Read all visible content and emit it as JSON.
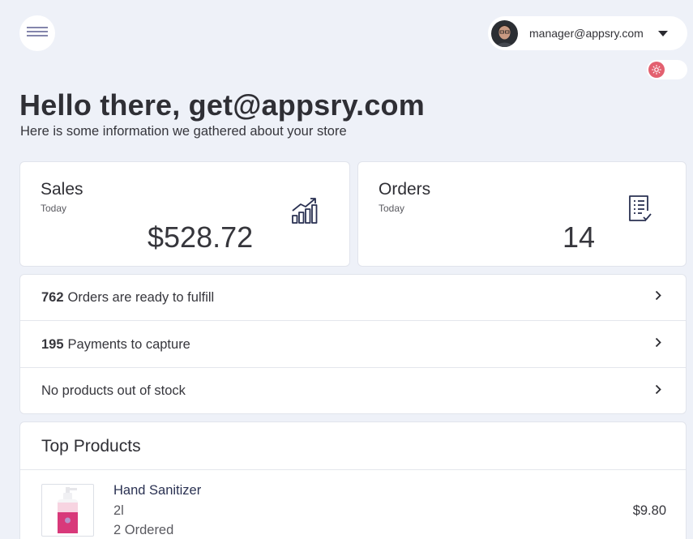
{
  "header": {
    "menu_icon": "hamburger-icon",
    "account": {
      "email": "manager@appsry.com",
      "avatar_icon": "user-avatar",
      "caret_icon": "caret-down-icon"
    },
    "theme_toggle": {
      "icon": "sun-icon",
      "on": false,
      "knob_color": "#e3606f"
    }
  },
  "welcome": {
    "title": "Hello there, get@appsry.com",
    "subtitle": "Here is some information we gathered about your store"
  },
  "stats": {
    "sales": {
      "title": "Sales",
      "period": "Today",
      "value": "$528.72",
      "icon": "chart-bar-trend-icon"
    },
    "orders": {
      "title": "Orders",
      "period": "Today",
      "value": "14",
      "icon": "checklist-icon"
    }
  },
  "tasks": [
    {
      "count": "762",
      "text": "Orders are ready to fulfill"
    },
    {
      "count": "195",
      "text": "Payments to capture"
    },
    {
      "count": "",
      "text": "No products out of stock"
    }
  ],
  "top_products": {
    "title": "Top Products",
    "items": [
      {
        "name": "Hand Sanitizer",
        "variant": "2l",
        "ordered": "2 Ordered",
        "price": "$9.80",
        "thumb_icon": "hand-sanitizer-bottle"
      }
    ]
  },
  "colors": {
    "background": "#eef1f8",
    "card": "#ffffff",
    "accent": "#e3606f",
    "icon_navy": "#2a3152"
  }
}
